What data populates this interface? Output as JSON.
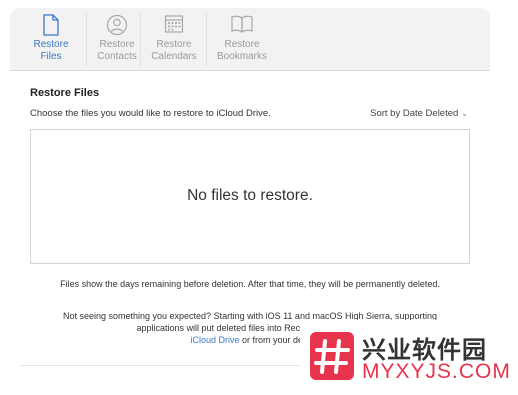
{
  "tabs": [
    {
      "line1": "Restore",
      "line2": "Files",
      "active": true,
      "icon": "file-icon"
    },
    {
      "line1": "Restore",
      "line2": "Contacts",
      "active": false,
      "icon": "contact-icon"
    },
    {
      "line1": "Restore",
      "line2": "Calendars",
      "active": false,
      "icon": "calendar-icon"
    },
    {
      "line1": "Restore",
      "line2": "Bookmarks",
      "active": false,
      "icon": "book-icon"
    }
  ],
  "main": {
    "title": "Restore Files",
    "subtitle": "Choose the files you would like to restore to iCloud Drive.",
    "sort_label": "Sort by Date Deleted",
    "empty_message": "No files to restore."
  },
  "notes": {
    "retention": "Files show the days remaining before deletion. After that time, they will be permanently deleted.",
    "hint_line1": "Not seeing something you expected? Starting with iOS 11 and macOS High Sierra, supporting",
    "hint_line2": "applications will put deleted files into Recently Deleted. Y",
    "hint_link": "iCloud Drive",
    "hint_line3": " or from your devi"
  },
  "watermark": {
    "cn_text": "兴业软件园",
    "en_text": "MYXYJS.COM"
  },
  "colors": {
    "accent": "#3c78c8",
    "tab_inactive": "#9a9a9a",
    "watermark_red": "#e8334c"
  }
}
